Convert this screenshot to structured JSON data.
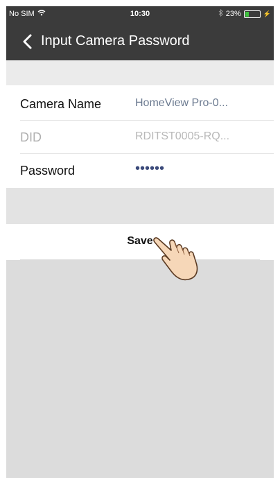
{
  "status_bar": {
    "carrier": "No SIM",
    "time": "10:30",
    "battery": "23%",
    "battery_level": 0.23,
    "icons": [
      "wifi-icon",
      "bluetooth-icon",
      "battery-icon"
    ]
  },
  "nav": {
    "title": "Input Camera Password",
    "back_icon": "chevron-left-icon"
  },
  "form": {
    "camera_name": {
      "label": "Camera Name",
      "value": "HomeView Pro-0..."
    },
    "did": {
      "label": "DID",
      "value": "RDITST0005-RQ..."
    },
    "password": {
      "label": "Password",
      "value": "••••••"
    }
  },
  "save_button": {
    "label": "Save"
  },
  "colors": {
    "navbar": "#3b3b3b",
    "section_gap": "#ebebeb",
    "background_lower": "#dcdcdc",
    "value_text": "#6b7a90",
    "password_dots": "#3b4a7a",
    "disabled_label": "#b0b0b0"
  }
}
